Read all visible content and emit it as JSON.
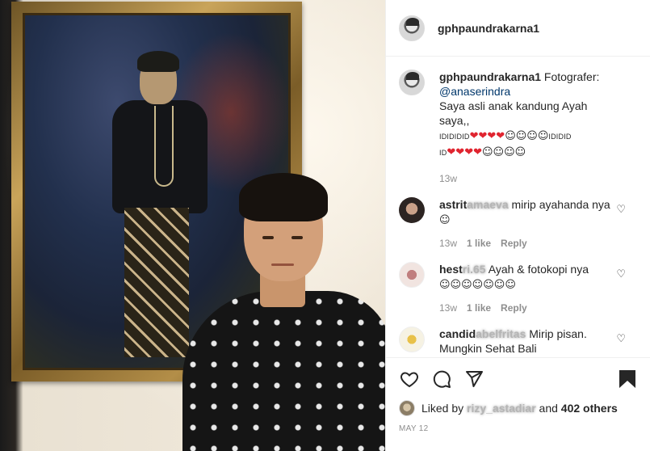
{
  "post": {
    "username": "gphpaundrakarna1"
  },
  "caption": {
    "username": "gphpaundrakarna1",
    "text_prefix": "Fotografer:",
    "mention": "@anaserindra",
    "line2": "Saya asli anak kandung Ayah saya,,",
    "emoji_line1_prefix": "IDIDIDID",
    "emoji_line1_suffix": "IDIDID",
    "emoji_line2_prefix": "ID",
    "time": "13w"
  },
  "comments": [
    {
      "username_visible": "astrit",
      "username_obscured": "amaeva",
      "text": "mirip ayahanda nya",
      "time": "13w",
      "likes": "1 like",
      "reply": "Reply"
    },
    {
      "username_visible": "hest",
      "username_obscured": "ri.65",
      "text": "Ayah & fotokopi nya",
      "time": "13w",
      "likes": "1 like",
      "reply": "Reply"
    },
    {
      "username_visible": "candid",
      "username_obscured": "abelfritas",
      "text": "Mirip pisan.",
      "text2": "Mungkin    Sehat    Bali"
    }
  ],
  "liked_by": {
    "prefix": "Liked by",
    "obscured_name": "rizy_astadiar",
    "conjunction": "and",
    "others": "402 others"
  },
  "date": "MAY 12",
  "icons": [
    "heart-icon",
    "comment-icon",
    "share-icon",
    "bookmark-icon"
  ],
  "colors": {
    "link": "#00376b",
    "meta": "#8e8e8e",
    "heart_emoji": "#e0242f"
  }
}
